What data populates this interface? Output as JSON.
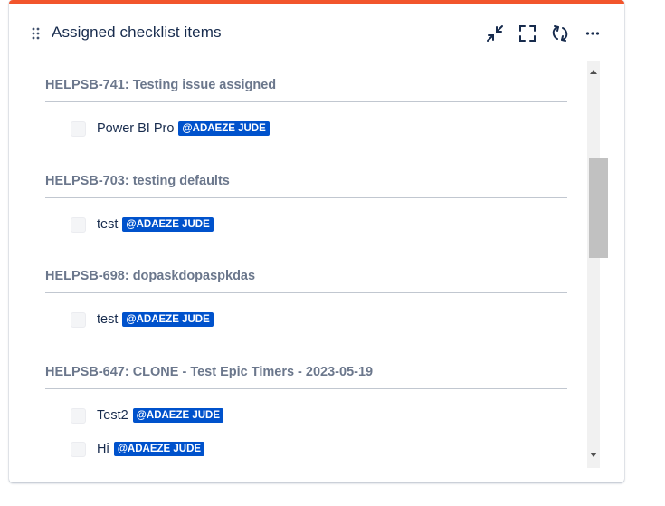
{
  "panel": {
    "title": "Assigned checklist items",
    "accent_color": "#f2552c",
    "actions": [
      {
        "name": "collapse-icon"
      },
      {
        "name": "fullscreen-icon"
      },
      {
        "name": "refresh-icon"
      },
      {
        "name": "more-icon"
      }
    ]
  },
  "groups": [
    {
      "heading": "HELPSB-741: Testing issue assigned",
      "items": [
        {
          "text": "Power BI Pro",
          "mention": "@ADAEZE JUDE"
        }
      ]
    },
    {
      "heading": "HELPSB-703: testing defaults",
      "items": [
        {
          "text": "test",
          "mention": "@ADAEZE JUDE"
        }
      ]
    },
    {
      "heading": "HELPSB-698: dopaskdopaspkdas",
      "items": [
        {
          "text": "test",
          "mention": "@ADAEZE JUDE"
        }
      ]
    },
    {
      "heading": "HELPSB-647: CLONE - Test Epic Timers - 2023-05-19",
      "items": [
        {
          "text": "Test2",
          "mention": "@ADAEZE JUDE"
        },
        {
          "text": "Hi",
          "mention": "@ADAEZE JUDE"
        }
      ]
    }
  ],
  "mention_color": "#0052cc"
}
